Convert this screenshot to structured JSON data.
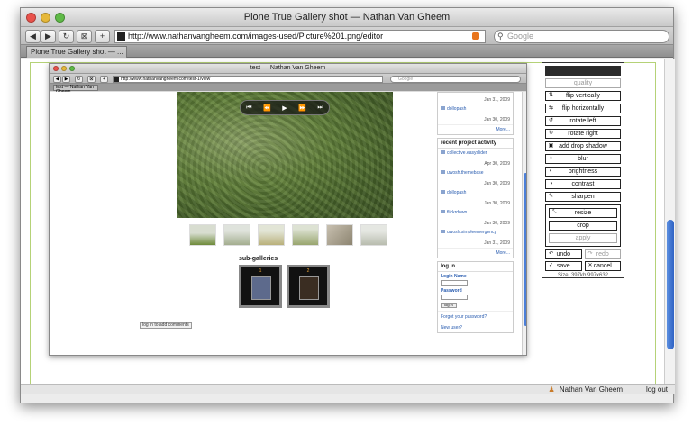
{
  "window": {
    "title": "Plone True Gallery shot — Nathan Van Gheem",
    "url": "http://www.nathanvangheem.com/images-used/Picture%201.png/editor",
    "search_placeholder": "Google",
    "tab_label": "Plone True Gallery shot — ..."
  },
  "toolbar": {
    "back": "◀",
    "forward": "▶",
    "reload": "↻",
    "snap": "⊠",
    "add": "+"
  },
  "inner_browser": {
    "title": "test — Nathan Van Gheem",
    "url": "http://www.nathanvangheem.com/test-1/view",
    "search_placeholder": "Google",
    "tab_label": "test — Nathan Van Gheem",
    "player_controls": [
      "⏮",
      "⏪",
      "▶",
      "⏩",
      "⏭"
    ],
    "sub_galleries_title": "sub-galleries",
    "sub_galleries": [
      {
        "number": "1"
      },
      {
        "number": "2"
      }
    ],
    "comments_button": "log in to add comments",
    "top_items": [
      {
        "name": "",
        "date": "Jan 31, 2009"
      },
      {
        "name": "dollopash",
        "date": "Jan 30, 2009"
      }
    ],
    "more_label": "More...",
    "activity_title": "recent project activity",
    "activity_items": [
      {
        "name": "collective.easyslider",
        "date": "Apr 30, 2009"
      },
      {
        "name": "uwosh.themebase",
        "date": "Jan 30, 2009"
      },
      {
        "name": "dollopash",
        "date": "Jan 30, 2009"
      },
      {
        "name": "flickrdown",
        "date": "Jan 30, 2009"
      },
      {
        "name": "uwosh.simpleemergency",
        "date": "Jan 31, 2009"
      }
    ],
    "login_title": "log in",
    "login_name_label": "Login Name",
    "password_label": "Password",
    "login_button": "log in",
    "forgot_link": "Forgot your password?",
    "new_user_link": "New user?"
  },
  "editor": {
    "buttons": [
      {
        "label": "quality",
        "icon": "",
        "disabled": true
      },
      {
        "label": "flip vertically",
        "icon": "flip-vertical-icon",
        "disabled": false
      },
      {
        "label": "flip horizontally",
        "icon": "flip-horizontal-icon",
        "disabled": false
      },
      {
        "label": "rotate left",
        "icon": "rotate-left-icon",
        "disabled": false
      },
      {
        "label": "rotate right",
        "icon": "rotate-right-icon",
        "disabled": false
      },
      {
        "label": "add drop shadow",
        "icon": "drop-shadow-icon",
        "disabled": false
      },
      {
        "label": "blur",
        "icon": "blur-icon",
        "disabled": false
      },
      {
        "label": "brightness",
        "icon": "brightness-icon",
        "disabled": false
      },
      {
        "label": "contrast",
        "icon": "contrast-icon",
        "disabled": false
      },
      {
        "label": "sharpen",
        "icon": "sharpen-icon",
        "disabled": false
      }
    ],
    "group_buttons": [
      {
        "label": "resize",
        "icon": "resize-icon",
        "disabled": false
      },
      {
        "label": "crop",
        "icon": "",
        "disabled": false
      },
      {
        "label": "apply",
        "icon": "",
        "disabled": true
      }
    ],
    "undo": "undo",
    "redo": "redo",
    "save": "save",
    "cancel": "cancel",
    "size_text": "Size: 397kb 997x632"
  },
  "status": {
    "user": "Nathan Van Gheem",
    "logout": "log out"
  },
  "colors": {
    "accent": "#2f63c4",
    "frame_green": "#b5d277"
  }
}
